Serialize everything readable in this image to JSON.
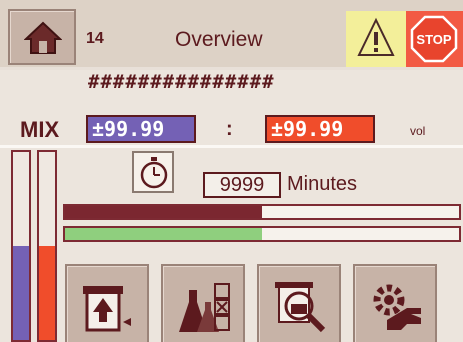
{
  "header": {
    "screen_number": "14",
    "title": "Overview",
    "stop_label": "STOP"
  },
  "status_line": "###############",
  "mix": {
    "label": "MIX",
    "value_a": "±99.99",
    "separator": ":",
    "value_b": "±99.99",
    "unit": "vol"
  },
  "timer": {
    "value": "9999",
    "unit_label": "Minutes"
  },
  "levels": {
    "tank_a_fraction": 0.5,
    "tank_b_fraction": 0.5,
    "progress_a_fraction": 0.5,
    "progress_b_fraction": 0.5
  },
  "colors": {
    "accent_dark": "#5c1a1e",
    "component_a": "#7461b5",
    "component_b": "#f04d2b",
    "progress_green": "#8fcf7e",
    "warning": "#f3ef9a",
    "stop": "#f25a43"
  },
  "icons": {
    "home": "home-icon",
    "warning": "warning-icon",
    "stop": "stop-sign-icon",
    "timer": "stopwatch-icon",
    "tool_1": "dispense-icon",
    "tool_2": "lab-flasks-icon",
    "tool_3": "inspect-icon",
    "tool_4": "settings-hand-icon"
  }
}
